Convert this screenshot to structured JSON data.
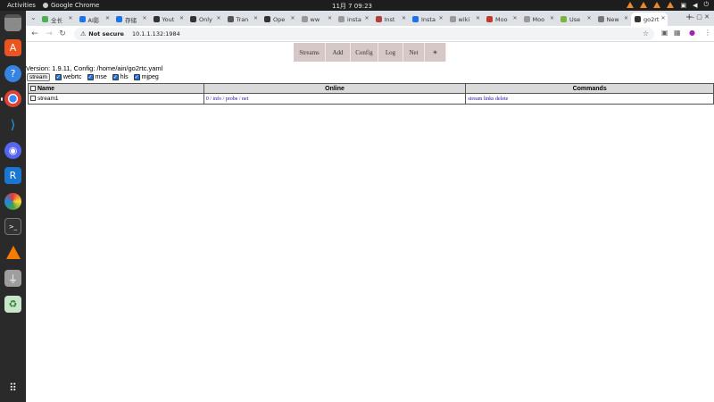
{
  "topbar": {
    "activities": "Activities",
    "app_name": "Google Chrome",
    "clock": "11月 7  09:23"
  },
  "tabs": [
    {
      "label": "全长",
      "color": "#4caf50"
    },
    {
      "label": "AI影",
      "color": "#1a73e8"
    },
    {
      "label": "存储",
      "color": "#1a73e8"
    },
    {
      "label": "Yout",
      "color": "#333333"
    },
    {
      "label": "Only",
      "color": "#333333"
    },
    {
      "label": "Tran",
      "color": "#555555"
    },
    {
      "label": "Ope",
      "color": "#333333"
    },
    {
      "label": "ww",
      "color": "#999999"
    },
    {
      "label": "insta",
      "color": "#999999"
    },
    {
      "label": "Inst",
      "color": "#b04040"
    },
    {
      "label": "Insta",
      "color": "#1a73e8"
    },
    {
      "label": "wiki",
      "color": "#999999"
    },
    {
      "label": "Moo",
      "color": "#c0392b"
    },
    {
      "label": "Moo",
      "color": "#999999"
    },
    {
      "label": "Use",
      "color": "#7cb342"
    },
    {
      "label": "New",
      "color": "#777777"
    },
    {
      "label": "go2rt",
      "color": "#333333"
    }
  ],
  "toolbar": {
    "not_secure": "Not secure",
    "url": "10.1.1.132:1984"
  },
  "menu": [
    "Streams",
    "Add",
    "Config",
    "Log",
    "Net",
    "☀"
  ],
  "version_text": "Version: 1.9.11, Config: /home/ain/go2rtc.yaml",
  "stream_button": "stream",
  "checkboxes": [
    {
      "label": "webrtc",
      "checked": true
    },
    {
      "label": "mse",
      "checked": true
    },
    {
      "label": "hls",
      "checked": true
    },
    {
      "label": "mjpeg",
      "checked": true
    }
  ],
  "table": {
    "headers": [
      "Name",
      "Online",
      "Commands"
    ],
    "rows": [
      {
        "name": "stream1",
        "online": "0 / info / probe / net",
        "commands": "stream links delete"
      }
    ]
  }
}
